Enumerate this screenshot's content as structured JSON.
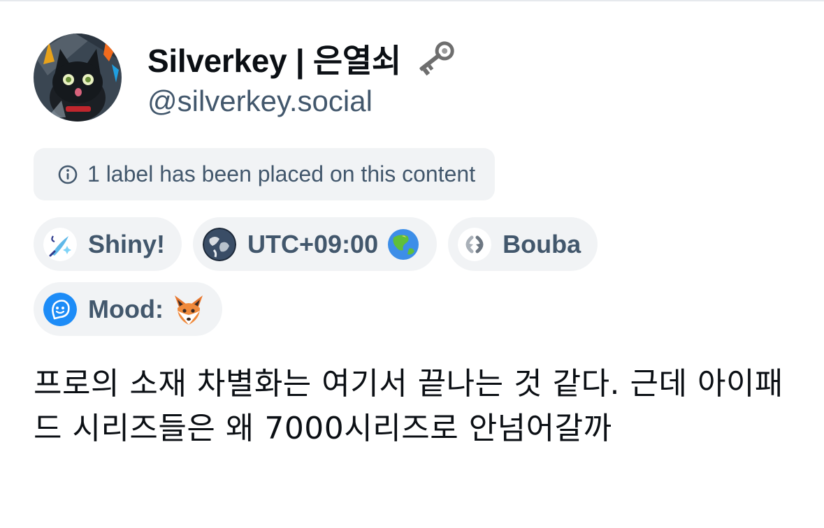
{
  "author": {
    "display_name": "Silverkey | 은열쇠",
    "handle": "@silverkey.social",
    "avatar_icon": "black-cat-avatar",
    "name_emoji_icon": "old-key-icon"
  },
  "moderation_notice": {
    "text": "1 label has been placed on this content",
    "icon": "info-circle-icon"
  },
  "labels": [
    {
      "label": "Shiny!",
      "icon": "sparkle-quill-icon"
    },
    {
      "label": "UTC+09:00",
      "icon": "globe-icon",
      "trailing_icon": "earth-asia-emoji"
    },
    {
      "label": "Bouba",
      "icon": "bouba-arrows-icon"
    },
    {
      "label": "Mood:",
      "icon": "mood-face-icon",
      "trailing_icon": "fox-emoji"
    }
  ],
  "post": {
    "text": "프로의 소재 차별화는 여기서 끝나는 것 같다. 근데 아이패드 시리즈들은 왜 7000시리즈로 안넘어갈까"
  },
  "colors": {
    "text_primary": "#0b0f14",
    "text_secondary": "#42576c",
    "pill_background": "#f1f3f5",
    "mood_blue": "#1d8cf7"
  }
}
